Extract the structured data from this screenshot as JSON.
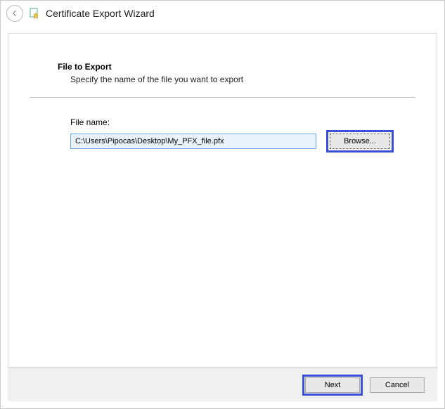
{
  "window": {
    "title": "Certificate Export Wizard"
  },
  "page": {
    "heading": "File to Export",
    "subheading": "Specify the name of the file you want to export"
  },
  "form": {
    "file_label": "File name:",
    "file_value": "C:\\Users\\Pipocas\\Desktop\\My_PFX_file.pfx",
    "browse_label": "Browse..."
  },
  "footer": {
    "next_label": "Next",
    "cancel_label": "Cancel"
  }
}
